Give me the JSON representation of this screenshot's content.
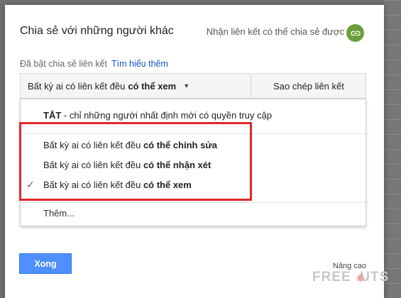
{
  "dialog": {
    "title": "Chia sẻ với những người khác",
    "get_link_label": "Nhận liên kết có thể chia sẻ được",
    "status": "Đã bật chia sẻ liên kết",
    "learn_more": "Tìm hiểu thêm"
  },
  "access": {
    "prefix": "Bất kỳ ai có liên kết đều",
    "selected": "có thể xem",
    "copy_label": "Sao chép liên kết"
  },
  "menu": {
    "off_strong": "TẮT",
    "off_rest": " - chỉ những người nhất định mới có quyền truy cập",
    "items": [
      {
        "prefix": "Bất kỳ ai có liên kết đều",
        "bold": "có thể chỉnh sửa"
      },
      {
        "prefix": "Bất kỳ ai có liên kết đều",
        "bold": "có thể nhận xét"
      },
      {
        "prefix": "Bất kỳ ai có liên kết đều",
        "bold": "có thể xem"
      }
    ],
    "more": "Thêm..."
  },
  "footer": {
    "done": "Xong",
    "advanced": "Nâng cao"
  },
  "watermark": "FREETUTS",
  "colors": {
    "primary": "#4d90fe",
    "link": "#1155cc",
    "link_icon": "#6c9f3a",
    "highlight": "#e3262d"
  }
}
